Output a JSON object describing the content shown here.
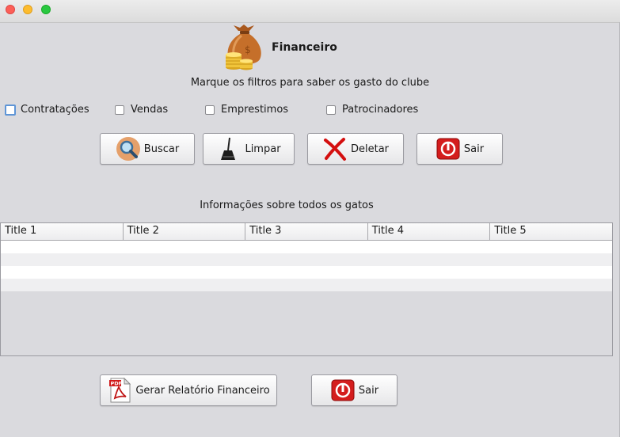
{
  "window": {
    "heading": "Financeiro",
    "subtitle": "Marque os filtros para saber os gasto do clube"
  },
  "filters": [
    {
      "label": "Contratações",
      "checked": false
    },
    {
      "label": "Vendas",
      "checked": false
    },
    {
      "label": "Emprestimos",
      "checked": false
    },
    {
      "label": "Patrocinadores",
      "checked": false
    }
  ],
  "actions": {
    "search_label": "Buscar",
    "clear_label": "Limpar",
    "delete_label": "Deletar",
    "exit_label": "Sair"
  },
  "table": {
    "title": "Informações sobre todos os gatos",
    "columns": [
      "Title 1",
      "Title 2",
      "Title 3",
      "Title 4",
      "Title 5"
    ],
    "rows": [
      [
        "",
        "",
        "",
        "",
        ""
      ],
      [
        "",
        "",
        "",
        "",
        ""
      ],
      [
        "",
        "",
        "",
        "",
        ""
      ],
      [
        "",
        "",
        "",
        "",
        ""
      ]
    ]
  },
  "footer": {
    "report_label": "Gerar Relatório Financeiro",
    "exit_label": "Sair"
  },
  "icons": {
    "logo": "money-bag-icon",
    "search": "magnifier-icon",
    "clear": "broom-icon",
    "delete": "red-x-icon",
    "exit": "power-icon",
    "report": "pdf-icon"
  }
}
